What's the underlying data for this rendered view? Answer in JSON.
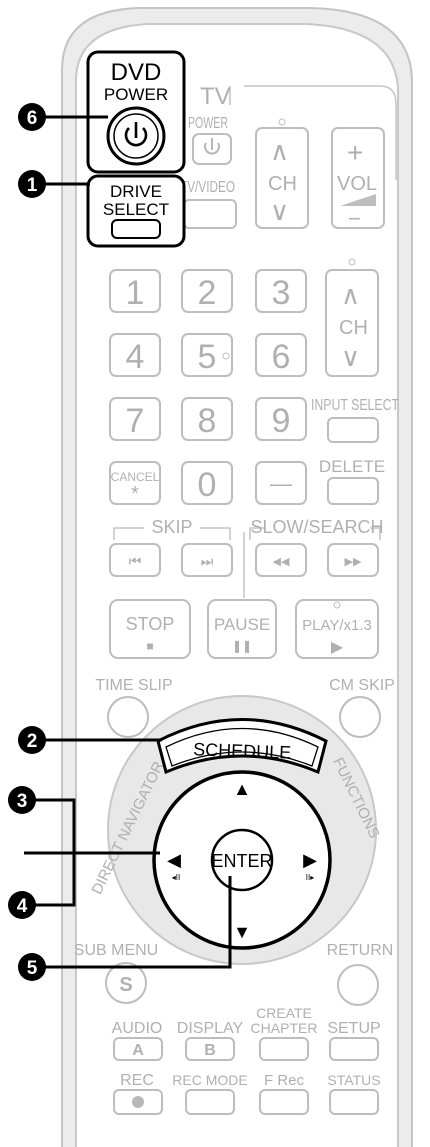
{
  "callouts": [
    "6",
    "1",
    "2",
    "3",
    "4",
    "5"
  ],
  "dvd_power": {
    "label1": "DVD",
    "label2": "POWER",
    "icon": "power-icon"
  },
  "drive_select": {
    "label1": "DRIVE",
    "label2": "SELECT"
  },
  "tv": {
    "title": "TV",
    "power": "POWER",
    "tv_video": "TV/VIDEO",
    "ch": "CH",
    "vol": "VOL",
    "plus": "+",
    "minus": "−"
  },
  "numpad": [
    "1",
    "2",
    "3",
    "4",
    "5",
    "6",
    "7",
    "8",
    "9",
    "0"
  ],
  "ch_side": "CH",
  "input_select": "INPUT SELECT",
  "cancel": "CANCEL",
  "cancel_sub": "*",
  "dash": "—",
  "delete": "DELETE",
  "skip": "SKIP",
  "slow_search": "SLOW/SEARCH",
  "skip_prev": "⏮",
  "skip_next": "⏭",
  "rew": "◀◀",
  "ff": "▶▶",
  "stop": "STOP",
  "pause": "PAUSE",
  "play": "PLAY/x1.3",
  "stop_sym": "■",
  "pause_sym": "❚❚",
  "play_sym": "▶",
  "time_slip": "TIME SLIP",
  "cm_skip": "CM SKIP",
  "schedule": "SCHEDULE",
  "direct_navigator": "DIRECT NAVIGATOR",
  "functions": "FUNCTIONS",
  "enter": "ENTER",
  "arrows": {
    "up": "▲",
    "down": "▼",
    "left": "◀",
    "right": "▶"
  },
  "sub_menu": "SUB MENU",
  "s_letter": "S",
  "return": "RETURN",
  "audio": "AUDIO",
  "display": "DISPLAY",
  "create_chapter_1": "CREATE",
  "create_chapter_2": "CHAPTER",
  "setup": "SETUP",
  "a_letter": "A",
  "b_letter": "B",
  "rec": "REC",
  "rec_mode": "REC MODE",
  "f_rec": "F Rec",
  "status": "STATUS"
}
